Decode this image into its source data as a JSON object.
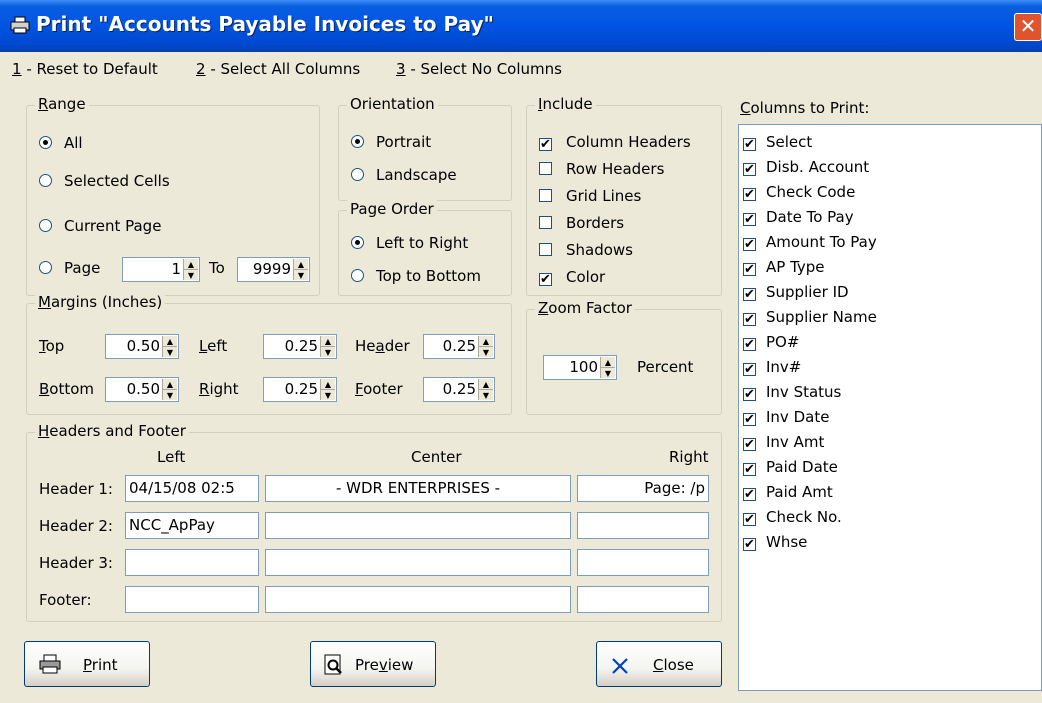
{
  "window": {
    "title": "Print \"Accounts Payable Invoices to Pay\"",
    "close_glyph": "✕"
  },
  "menu": [
    {
      "key": "1",
      "label": " - Reset to Default"
    },
    {
      "key": "2",
      "label": " - Select All Columns"
    },
    {
      "key": "3",
      "label": " - Select No Columns"
    }
  ],
  "range": {
    "title": "Range",
    "all": "All",
    "selected_cells": "Selected Cells",
    "current_page": "Current Page",
    "page": "Page",
    "page_from": "1",
    "to": "To",
    "page_to": "9999",
    "selected": "All"
  },
  "orientation": {
    "title": "Orientation",
    "portrait": "Portrait",
    "landscape": "Landscape",
    "selected": "Portrait"
  },
  "page_order": {
    "title": "Page Order",
    "ltr": "Left to Right",
    "ttb": "Top to Bottom",
    "selected": "Left to Right"
  },
  "include": {
    "title": "Include",
    "items": [
      {
        "label": "Column Headers",
        "checked": true
      },
      {
        "label": "Row Headers",
        "checked": false
      },
      {
        "label": "Grid Lines",
        "checked": false
      },
      {
        "label": "Borders",
        "checked": false
      },
      {
        "label": "Shadows",
        "checked": false
      },
      {
        "label": "Color",
        "checked": true
      }
    ]
  },
  "margins": {
    "title": "Margins (Inches)",
    "top_label": "Top",
    "top": "0.50",
    "left_label": "Left",
    "left": "0.25",
    "header_label": "Header",
    "header": "0.25",
    "bottom_label": "Bottom",
    "bottom": "0.50",
    "right_label": "Right",
    "right": "0.25",
    "footer_label": "Footer",
    "footer": "0.25"
  },
  "zoom": {
    "title": "Zoom Factor",
    "value": "100",
    "unit": "Percent"
  },
  "headers_footer": {
    "title": "Headers and Footer",
    "col_left": "Left",
    "col_center": "Center",
    "col_right": "Right",
    "rows": [
      {
        "label": "Header 1:",
        "left": "04/15/08  02:5",
        "center": "-   WDR ENTERPRISES   -",
        "right": "Page: /p"
      },
      {
        "label": "Header 2:",
        "left": "NCC_ApPay",
        "center": "",
        "right": ""
      },
      {
        "label": "Header 3:",
        "left": "",
        "center": "",
        "right": ""
      },
      {
        "label": "Footer:",
        "left": "",
        "center": "",
        "right": ""
      }
    ]
  },
  "columns": {
    "title": "Columns to Print:",
    "items": [
      "Select",
      "Disb. Account",
      "Check Code",
      "Date To Pay",
      "Amount To Pay",
      "AP Type",
      "Supplier ID",
      "Supplier Name",
      "PO#",
      "Inv#",
      "Inv Status",
      "Inv Date",
      "Inv Amt",
      "Paid Date",
      "Paid Amt",
      "Check No.",
      "Whse"
    ]
  },
  "buttons": {
    "print": "Print",
    "preview": "Preview",
    "close": "Close"
  },
  "colors": {
    "title_bar": "#0054E3",
    "dialog_bg": "#ECE9D8",
    "close_red": "#E0532F",
    "close_x_blue": "#0040C0"
  },
  "check_glyph": "✔"
}
